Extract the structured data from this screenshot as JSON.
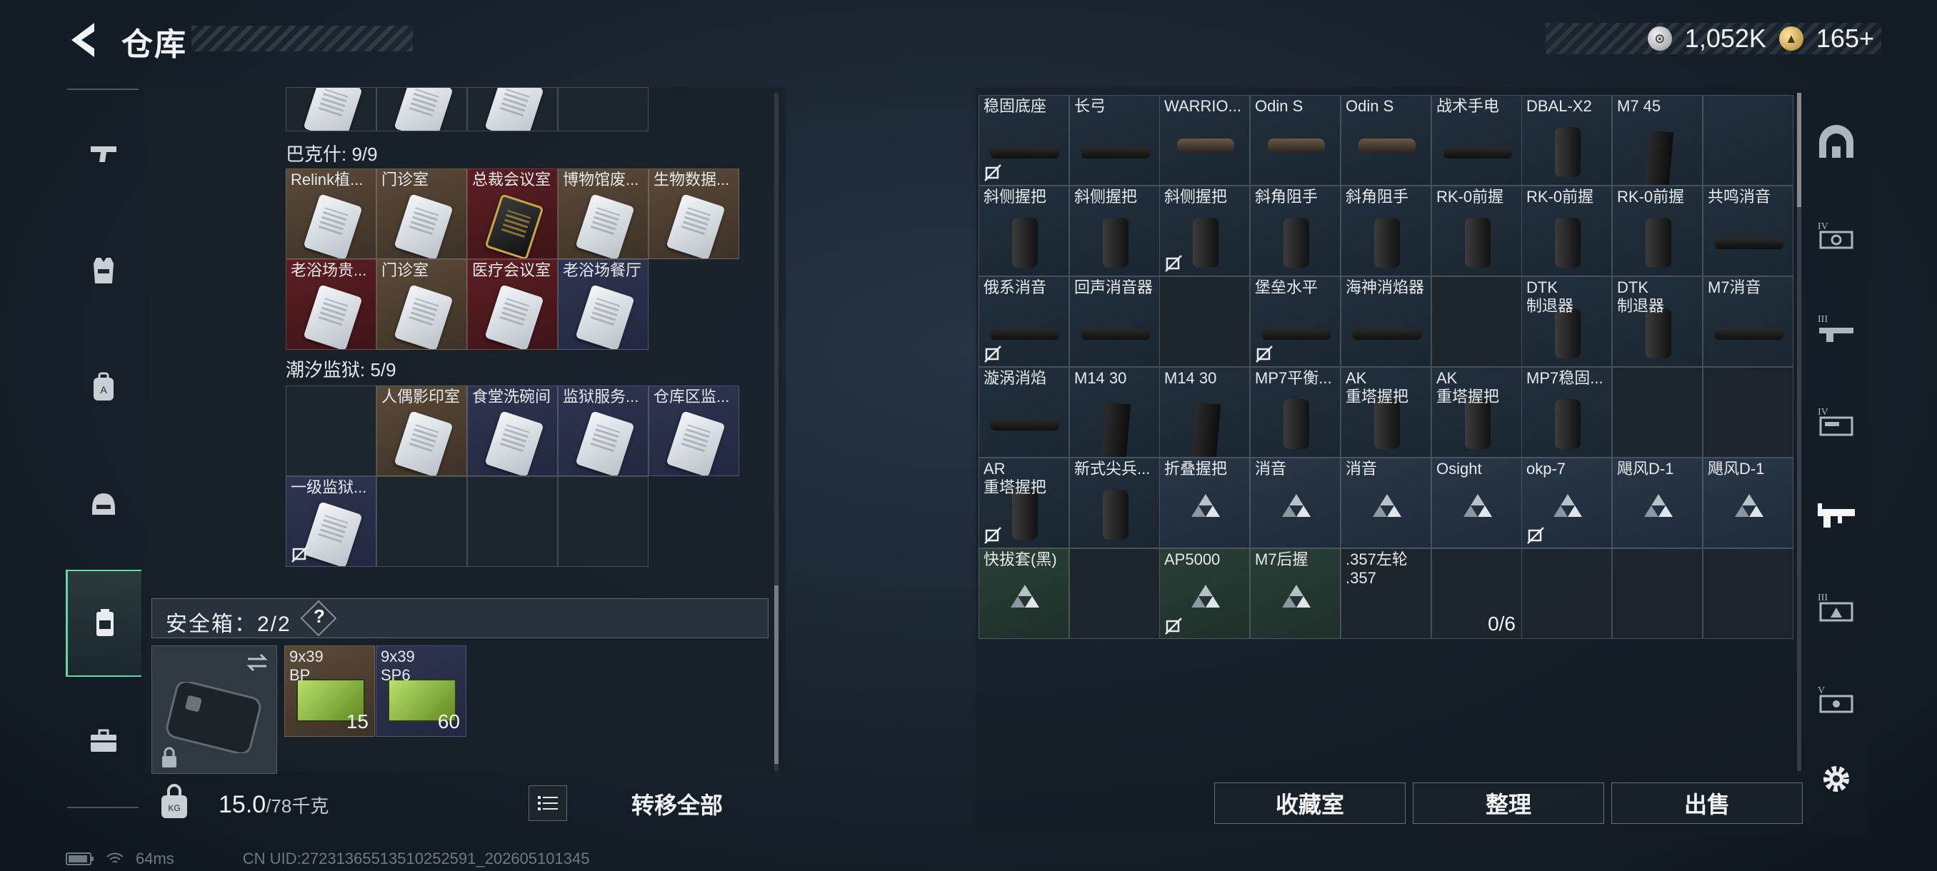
{
  "header": {
    "title": "仓库",
    "currency": [
      {
        "icon": "silver-coin-icon",
        "value": "1,052K"
      },
      {
        "icon": "gold-coin-icon",
        "value": "165+"
      }
    ]
  },
  "left_nav": [
    {
      "icon": "pistol-icon"
    },
    {
      "icon": "vest-icon"
    },
    {
      "icon": "backpack-icon"
    },
    {
      "icon": "helmet-icon"
    },
    {
      "icon": "keycard-case-icon",
      "active": true
    },
    {
      "icon": "toolbox-icon"
    }
  ],
  "left_inventory": {
    "sections": [
      {
        "title": "巴克什: 9/9",
        "cells": [
          {
            "label": "Relink植...",
            "bg": "brown"
          },
          {
            "label": "门诊室",
            "bg": "brown"
          },
          {
            "label": "总裁会议室",
            "bg": "red",
            "gold": true
          },
          {
            "label": "博物馆废...",
            "bg": "brown"
          },
          {
            "label": "生物数据...",
            "bg": "brown"
          },
          {
            "label": "老浴场贵...",
            "bg": "red"
          },
          {
            "label": "门诊室",
            "bg": "brown"
          },
          {
            "label": "医疗会议室",
            "bg": "red"
          },
          {
            "label": "老浴场餐厅",
            "bg": "navy"
          }
        ]
      },
      {
        "title": "潮汐监狱: 5/9",
        "cells": [
          {
            "label": "",
            "bg": "dark"
          },
          {
            "label": "人偶影印室",
            "bg": "brown"
          },
          {
            "label": "食堂洗碗间",
            "bg": "navy"
          },
          {
            "label": "监狱服务...",
            "bg": "navy"
          },
          {
            "label": "仓库区监...",
            "bg": "navy"
          },
          {
            "label": "一级监狱...",
            "bg": "navy",
            "locked": true
          }
        ]
      }
    ]
  },
  "safe_box": {
    "label": "安全箱：2/2",
    "help": "?",
    "items": [
      {
        "label": "9x39\nBP",
        "count": "15"
      },
      {
        "label": "9x39\nSP6",
        "count": "60"
      }
    ]
  },
  "bottom_left": {
    "weight": "15.0",
    "weight_max": "/78千克",
    "transfer_all": "转移全部"
  },
  "status_bar": {
    "ping": "64ms",
    "uid": "CN UID:27231365513510252591_202605101345"
  },
  "right_inventory": {
    "cells": [
      {
        "label": "稳固底座",
        "bg": "teal",
        "locked": true,
        "gadget": "long"
      },
      {
        "label": "长弓",
        "bg": "teal",
        "gadget": "long"
      },
      {
        "label": "WARRIO...",
        "bg": "teal",
        "gadget": "torch"
      },
      {
        "label": "Odin S",
        "bg": "teal",
        "gadget": "torch"
      },
      {
        "label": "Odin S",
        "bg": "teal",
        "gadget": "torch"
      },
      {
        "label": "战术手电",
        "bg": "teal",
        "gadget": "long"
      },
      {
        "label": "DBAL-X2",
        "bg": "teal",
        "gadget": "grip"
      },
      {
        "label": "M7 45",
        "bg": "teal",
        "gadget": "mag"
      },
      {
        "label": "",
        "bg": "teal",
        "gadget": "none"
      },
      {
        "label": "斜侧握把",
        "bg": "teal",
        "gadget": "grip"
      },
      {
        "label": "斜侧握把",
        "bg": "teal",
        "gadget": "grip"
      },
      {
        "label": "斜侧握把",
        "bg": "teal",
        "locked": true,
        "gadget": "grip"
      },
      {
        "label": "斜角阻手",
        "bg": "teal",
        "gadget": "grip"
      },
      {
        "label": "斜角阻手",
        "bg": "teal",
        "gadget": "grip"
      },
      {
        "label": "RK-0前握",
        "bg": "teal",
        "gadget": "grip"
      },
      {
        "label": "RK-0前握",
        "bg": "teal",
        "gadget": "grip"
      },
      {
        "label": "RK-0前握",
        "bg": "teal",
        "gadget": "grip"
      },
      {
        "label": "共鸣消音",
        "bg": "teal",
        "gadget": "long"
      },
      {
        "label": "俄系消音",
        "bg": "teal",
        "locked": true,
        "gadget": "long"
      },
      {
        "label": "回声消音器",
        "bg": "teal",
        "gadget": "long"
      },
      {
        "label": "",
        "bg": "dark",
        "gadget": "none"
      },
      {
        "label": "堡垒水平",
        "bg": "teal",
        "locked": true,
        "gadget": "long"
      },
      {
        "label": "海神消焰器",
        "bg": "teal",
        "gadget": "long"
      },
      {
        "label": "",
        "bg": "dark",
        "gadget": "none"
      },
      {
        "label": "DTK\n制退器",
        "bg": "teal",
        "gadget": "grip"
      },
      {
        "label": "DTK\n制退器",
        "bg": "teal",
        "gadget": "grip"
      },
      {
        "label": "M7消音",
        "bg": "teal",
        "gadget": "long"
      },
      {
        "label": "漩涡消焰",
        "bg": "teal",
        "gadget": "long"
      },
      {
        "label": "M14 30",
        "bg": "teal",
        "gadget": "mag"
      },
      {
        "label": "M14 30",
        "bg": "teal",
        "gadget": "mag"
      },
      {
        "label": "MP7平衡...",
        "bg": "teal",
        "gadget": "grip"
      },
      {
        "label": "AK\n重塔握把",
        "bg": "teal",
        "gadget": "grip"
      },
      {
        "label": "AK\n重塔握把",
        "bg": "teal",
        "gadget": "grip"
      },
      {
        "label": "MP7稳固...",
        "bg": "teal",
        "gadget": "grip"
      },
      {
        "label": "",
        "bg": "dark",
        "gadget": "none"
      },
      {
        "label": "",
        "bg": "dark",
        "gadget": "none"
      },
      {
        "label": "AR\n重塔握把",
        "bg": "teal",
        "locked": true,
        "gadget": "grip"
      },
      {
        "label": "新式尖兵...",
        "bg": "teal",
        "gadget": "grip"
      },
      {
        "label": "折叠握把",
        "bg": "blue",
        "gadget": "tri"
      },
      {
        "label": "消音",
        "bg": "blue",
        "gadget": "tri"
      },
      {
        "label": "消音",
        "bg": "blue",
        "gadget": "tri"
      },
      {
        "label": "Osight",
        "bg": "blue",
        "gadget": "tri"
      },
      {
        "label": "okp-7",
        "bg": "blue",
        "locked": true,
        "gadget": "tri"
      },
      {
        "label": "飓风D-1",
        "bg": "blue",
        "gadget": "tri"
      },
      {
        "label": "飓风D-1",
        "bg": "blue",
        "gadget": "tri"
      },
      {
        "label": "快拔套(黑)",
        "bg": "green",
        "gadget": "tri"
      },
      {
        "label": "",
        "bg": "dark",
        "gadget": "none"
      },
      {
        "label": "AP5000",
        "bg": "green",
        "locked": true,
        "gadget": "tri"
      },
      {
        "label": "M7后握",
        "bg": "green",
        "gadget": "tri"
      },
      {
        "label": ".357左轮\n.357",
        "bg": "dark",
        "gadget": "none"
      },
      {
        "label": "",
        "bg": "dark",
        "gadget": "none",
        "count": "0/6"
      },
      {
        "label": "",
        "bg": "dark",
        "gadget": "none"
      },
      {
        "label": "",
        "bg": "dark",
        "gadget": "none"
      },
      {
        "label": "",
        "bg": "dark",
        "gadget": "none"
      }
    ]
  },
  "bottom_right": {
    "buttons": [
      "收藏室",
      "整理",
      "出售"
    ]
  },
  "right_nav": [
    {
      "icon": "arch-icon"
    },
    {
      "icon": "weapon-iv-icon"
    },
    {
      "icon": "weapon-iii-icon"
    },
    {
      "icon": "weapon-iv-b-icon"
    },
    {
      "icon": "weapon-active-icon",
      "active": true
    },
    {
      "icon": "weapon-iii-b-icon"
    },
    {
      "icon": "weapon-v-icon"
    },
    {
      "icon": "gear-icon"
    }
  ]
}
